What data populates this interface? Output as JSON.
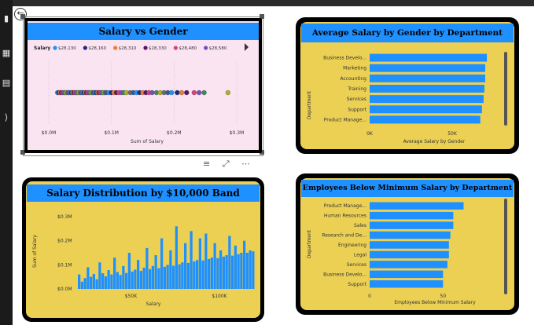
{
  "ui": {
    "back_icon": "back-arrow-icon",
    "nav_icons": [
      "report-icon",
      "table-icon",
      "model-icon",
      "dax-icon"
    ],
    "visual_tools": [
      "filter-icon",
      "focus-mode-icon",
      "more-options-icon"
    ],
    "colors": {
      "title_bar": "#1e90ff",
      "bars": "#1e90ff",
      "card_bg": "#ecd053",
      "scatter_bg": "#fbe4f2"
    }
  },
  "charts": {
    "salary_gender": {
      "title": "Salary vs Gender",
      "legend_label": "Salary",
      "legend_items": [
        {
          "label": "$28,130",
          "color": "#1e90ff"
        },
        {
          "label": "$28,160",
          "color": "#1b2a7a"
        },
        {
          "label": "$28,310",
          "color": "#f07a3a"
        },
        {
          "label": "$28,330",
          "color": "#5a1460"
        },
        {
          "label": "$28,480",
          "color": "#d9417a"
        },
        {
          "label": "$28,580",
          "color": "#7b4bbf"
        }
      ],
      "x_ticks": [
        "$0.0M",
        "$0.1M",
        "$0.2M",
        "$0.3M"
      ],
      "xlabel": "Sum of Salary"
    },
    "avg_salary": {
      "title": "Average Salary by Gender by Department",
      "ylabel": "Department",
      "xlabel": "Average Salary by Gender",
      "x_ticks": [
        "0K",
        "50K"
      ]
    },
    "distribution": {
      "title": "Salary Distribution by $10,000 Band",
      "ylabel": "Sum of Salary",
      "xlabel": "Salary",
      "y_ticks": [
        "$0.3M",
        "$0.2M",
        "$0.1M",
        "$0.0M"
      ],
      "x_ticks": [
        "$50K",
        "$100K"
      ]
    },
    "below_min": {
      "title": "Employees Below Minimum Salary by Department",
      "ylabel": "Department",
      "xlabel": "Employees Below Minimum Salary",
      "x_ticks": [
        "0",
        "50"
      ]
    }
  },
  "chart_data": [
    {
      "type": "scatter",
      "title": "Salary vs Gender",
      "xlabel": "Sum of Salary",
      "xlim": [
        0,
        300000
      ],
      "legend_title": "Salary",
      "legend": [
        "$28,130",
        "$28,160",
        "$28,310",
        "$28,330",
        "$28,480",
        "$28,580"
      ],
      "x": [
        14000,
        16000,
        18000,
        20000,
        22000,
        24000,
        26000,
        28000,
        30000,
        32000,
        34000,
        36000,
        38000,
        40000,
        42000,
        44000,
        46000,
        48000,
        50000,
        52000,
        54000,
        56000,
        58000,
        60000,
        62000,
        64000,
        66000,
        68000,
        70000,
        72000,
        74000,
        76000,
        78000,
        80000,
        82000,
        84000,
        86000,
        88000,
        90000,
        92000,
        96000,
        100000,
        104000,
        108000,
        112000,
        116000,
        120000,
        124000,
        130000,
        135000,
        140000,
        145000,
        150000,
        155000,
        160000,
        165000,
        172000,
        178000,
        184000,
        190000,
        196000,
        205000,
        212000,
        220000,
        232000,
        240000,
        248000,
        286000
      ]
    },
    {
      "type": "bar",
      "title": "Average Salary by Gender by Department",
      "orientation": "horizontal",
      "xlabel": "Average Salary by Gender",
      "ylabel": "Department",
      "xlim": [
        0,
        80000
      ],
      "categories": [
        "Business Develo...",
        "Marketing",
        "Accounting",
        "Training",
        "Services",
        "Support",
        "Product Manage..."
      ],
      "values": [
        71000,
        70000,
        70000,
        69500,
        69000,
        68000,
        67000
      ]
    },
    {
      "type": "bar",
      "title": "Salary Distribution by $10,000 Band",
      "xlabel": "Salary",
      "ylabel": "Sum of Salary",
      "ylim": [
        0,
        300000
      ],
      "xlim": [
        20000,
        120000
      ],
      "values": [
        60000,
        30000,
        45000,
        90000,
        50000,
        62000,
        40000,
        110000,
        65000,
        52000,
        78000,
        60000,
        130000,
        70000,
        58000,
        95000,
        66000,
        150000,
        72000,
        80000,
        120000,
        75000,
        88000,
        170000,
        82000,
        95000,
        140000,
        86000,
        210000,
        92000,
        100000,
        160000,
        96000,
        260000,
        102000,
        110000,
        190000,
        108000,
        240000,
        114000,
        120000,
        210000,
        118000,
        230000,
        124000,
        130000,
        190000,
        128000,
        160000,
        134000,
        140000,
        220000,
        138000,
        180000,
        144000,
        150000,
        200000,
        150000,
        160000,
        156000
      ]
    },
    {
      "type": "bar",
      "title": "Employees Below Minimum Salary by Department",
      "orientation": "horizontal",
      "xlabel": "Employees Below Minimum Salary",
      "ylabel": "Department",
      "xlim": [
        0,
        90
      ],
      "categories": [
        "Product Manage...",
        "Human Resources",
        "Sales",
        "Research and De...",
        "Engineering",
        "Legal",
        "Services",
        "Business Develo...",
        "Support"
      ],
      "values": [
        64,
        57,
        57,
        55,
        54,
        54,
        53,
        50,
        50
      ]
    }
  ]
}
